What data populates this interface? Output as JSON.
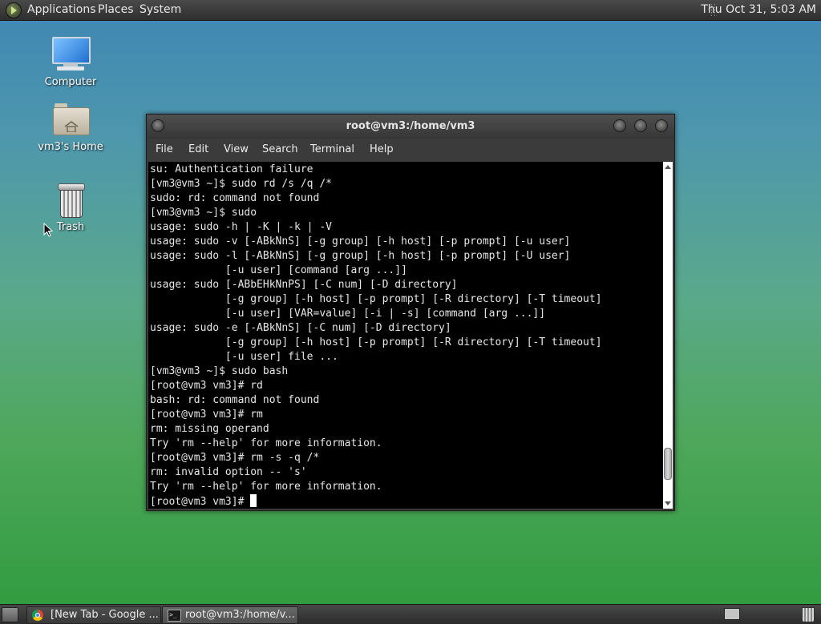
{
  "top_panel": {
    "menus": [
      "Applications",
      "Places",
      "System"
    ],
    "clock": "Thu Oct 31,  5:03 AM"
  },
  "desktop_icons": {
    "computer": "Computer",
    "home": "vm3's Home",
    "trash": "Trash"
  },
  "terminal": {
    "title": "root@vm3:/home/vm3",
    "menu": [
      "File",
      "Edit",
      "View",
      "Search",
      "Terminal",
      "Help"
    ],
    "lines": [
      "su: Authentication failure",
      "[vm3@vm3 ~]$ sudo rd /s /q /*",
      "sudo: rd: command not found",
      "[vm3@vm3 ~]$ sudo",
      "usage: sudo -h | -K | -k | -V",
      "usage: sudo -v [-ABkNnS] [-g group] [-h host] [-p prompt] [-u user]",
      "usage: sudo -l [-ABkNnS] [-g group] [-h host] [-p prompt] [-U user]",
      "            [-u user] [command [arg ...]]",
      "usage: sudo [-ABbEHkNnPS] [-C num] [-D directory]",
      "            [-g group] [-h host] [-p prompt] [-R directory] [-T timeout]",
      "            [-u user] [VAR=value] [-i | -s] [command [arg ...]]",
      "usage: sudo -e [-ABkNnS] [-C num] [-D directory]",
      "            [-g group] [-h host] [-p prompt] [-R directory] [-T timeout]",
      "            [-u user] file ...",
      "[vm3@vm3 ~]$ sudo bash",
      "[root@vm3 vm3]# rd",
      "bash: rd: command not found",
      "[root@vm3 vm3]# rm",
      "rm: missing operand",
      "Try 'rm --help' for more information.",
      "[root@vm3 vm3]# rm -s -q /*",
      "rm: invalid option -- 's'",
      "Try 'rm --help' for more information."
    ],
    "prompt": "[root@vm3 vm3]# ",
    "scroll_position": 0.94
  },
  "taskbar": {
    "tasks": [
      {
        "label": "[New Tab - Google ...",
        "icon": "chrome-icon",
        "active": false
      },
      {
        "label": "root@vm3:/home/v...",
        "icon": "terminal-icon",
        "active": true
      }
    ]
  }
}
